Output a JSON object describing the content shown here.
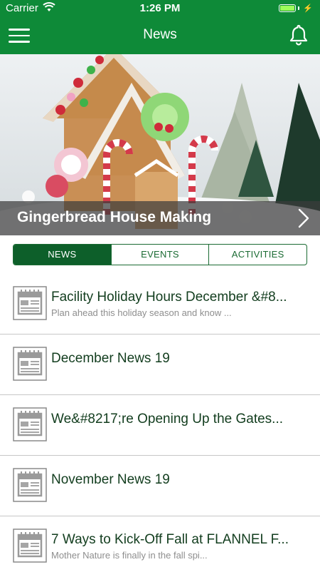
{
  "status": {
    "carrier": "Carrier",
    "time": "1:26 PM",
    "battery_level": 1.0
  },
  "nav": {
    "title": "News",
    "menu_icon": "hamburger-menu-icon",
    "bell_icon": "bell-icon"
  },
  "hero": {
    "caption": "Gingerbread House Making",
    "image": "gingerbread house photo",
    "next_icon": "chevron-right-icon"
  },
  "tabs": [
    {
      "label": "NEWS",
      "active": true
    },
    {
      "label": "EVENTS",
      "active": false
    },
    {
      "label": "ACTIVITIES",
      "active": false
    }
  ],
  "news": [
    {
      "title": "Facility Holiday Hours December &#8...",
      "subtitle": "Plan ahead this holiday season and know ..."
    },
    {
      "title": "December News 19",
      "subtitle": ""
    },
    {
      "title": "We&#8217;re Opening Up the Gates...",
      "subtitle": ""
    },
    {
      "title": "November News 19",
      "subtitle": ""
    },
    {
      "title": "7 Ways to Kick-Off Fall at FLANNEL F...",
      "subtitle": "Mother Nature is finally in the fall spi..."
    }
  ],
  "colors": {
    "primary": "#0e8a38",
    "tab_active": "#0d5f2a",
    "title_text": "#123d1e"
  }
}
